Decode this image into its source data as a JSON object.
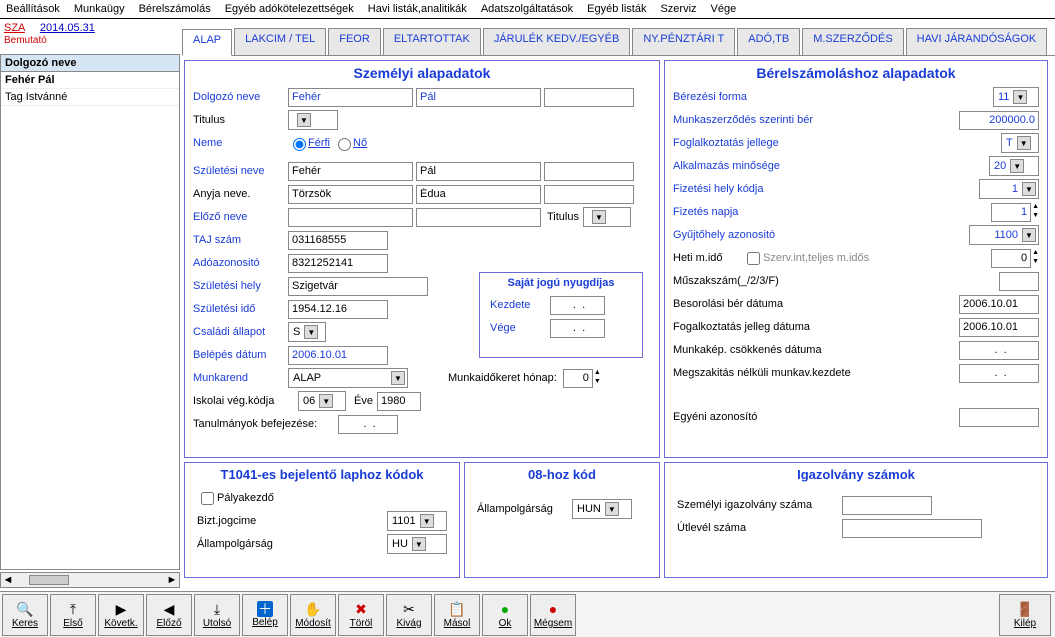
{
  "menu": [
    "Beállítások",
    "Munkaügy",
    "Bérelszámolás",
    "Egyéb adókötelezettségek",
    "Havi listák,analitikák",
    "Adatszolgáltatások",
    "Egyéb listák",
    "Szerviz",
    "Vége"
  ],
  "header": {
    "sza": "SZA",
    "date": "2014.05.31",
    "bemutato": "Bemutató"
  },
  "list": {
    "title": "Dolgozó neve",
    "items": [
      "Fehér Pál",
      "Tag Istvánné"
    ]
  },
  "tabs": [
    "ALAP",
    "LAKCIM / TEL",
    "FEOR",
    "ELTARTOTTAK",
    "JÁRULÉK KEDV./EGYÉB",
    "NY.PÉNZTÁRI T",
    "ADÓ,TB",
    "M.SZERZŐDÉS",
    "HAVI JÁRANDÓSÁGOK"
  ],
  "personal": {
    "title": "Személyi alapadatok",
    "labels": {
      "dolgozo": "Dolgozó neve",
      "titulus": "Titulus",
      "neme": "Neme",
      "ferfi": "Férfi",
      "no": "Nő",
      "szulnev": "Születési neve",
      "anyja": "Anyja neve.",
      "elozo": "Előző neve",
      "titulus2": "Titulus",
      "taj": "TAJ szám",
      "ado": "Adóazonositó",
      "szhely": "Születési hely",
      "szido": "Születési idő",
      "csalad": "Családi állapot",
      "belepes": "Belépés dátum",
      "munkarend": "Munkarend",
      "iskola": "Iskolai vég.kódja",
      "eve": "Éve",
      "tanulm": "Tanulmányok befejezése:",
      "mkh": "Munkaidőkeret hónap:",
      "sajat": "Saját jogú nyugdíjas",
      "kezdete": "Kezdete",
      "vege": "Vége"
    },
    "values": {
      "last": "Fehér",
      "first": "Pál",
      "szul_last": "Fehér",
      "szul_first": "Pál",
      "anyja_last": "Törzsök",
      "anyja_first": "Édua",
      "taj": "031168555",
      "ado": "8321252141",
      "szhely": "Szigetvár",
      "szido": "1954.12.16",
      "csalad": "S",
      "belepes": "2006.10.01",
      "munkarend": "ALAP",
      "iskola": "06",
      "eve": "1980",
      "tanulm_date": " .  .",
      "mkh": "0",
      "kezdete": " .  .",
      "vege": " .  ."
    }
  },
  "payroll": {
    "title": "Bérelszámoláshoz alapadatok",
    "labels": {
      "berforma": "Bérezési forma",
      "mszerz": "Munkaszerződés szerinti bér",
      "foglalk": "Foglalkoztatás jellege",
      "alkmin": "Alkalmazás minősége",
      "fizhely": "Fizetési hely kódja",
      "fiznap": "Fizetés napja",
      "gyujto": "Gyűjtőhely azonositó",
      "heti": "Heti m.idő",
      "szerv": "Szerv.int,teljes m.idős",
      "muszak": "Műszakszám(_/2/3/F)",
      "besor": "Besorolási bér dátuma",
      "fogjell": "Fogalkoztatás jelleg dátuma",
      "mkcs": "Munkakép. csökkenés dátuma",
      "megszak": "Megszakitás nélküli munkav.kezdete",
      "egyeni": "Egyéni azonosító"
    },
    "values": {
      "berforma": "11",
      "mszerz": "200000.0",
      "foglalk": "T",
      "alkmin": "20",
      "fizhely": "1",
      "fiznap": "1",
      "gyujto": "1100",
      "heti": "0",
      "muszak": "",
      "besor": "2006.10.01",
      "fogjell": "2006.10.01",
      "mkcs": " .  .",
      "megszak": " .  .",
      "egyeni": ""
    }
  },
  "t1041": {
    "title": "T1041-es bejelentő laphoz kódok",
    "labels": {
      "palya": "Pályakezdő",
      "bizt": "Bizt.jogcime",
      "allamp": "Állampolgárság"
    },
    "values": {
      "bizt": "1101",
      "allamp": "HU"
    }
  },
  "kod08": {
    "title": "08-hoz kód",
    "labels": {
      "allamp": "Állampolgárság"
    },
    "values": {
      "allamp": "HUN"
    }
  },
  "igaz": {
    "title": "Igazolvány számok",
    "labels": {
      "szig": "Személyi igazolvány száma",
      "utlevel": "Útlevél száma"
    }
  },
  "buttons": {
    "keres": "Keres",
    "elso": "Első",
    "kovetk": "Követk.",
    "elozo": "Előző",
    "utolso": "Utolsó",
    "belep": "Belép",
    "modosit": "Módosít",
    "torol": "Töröl",
    "kivag": "Kivág",
    "masol": "Másol",
    "ok": "Ok",
    "megsem": "Mégsem",
    "kilep": "Kilép"
  }
}
